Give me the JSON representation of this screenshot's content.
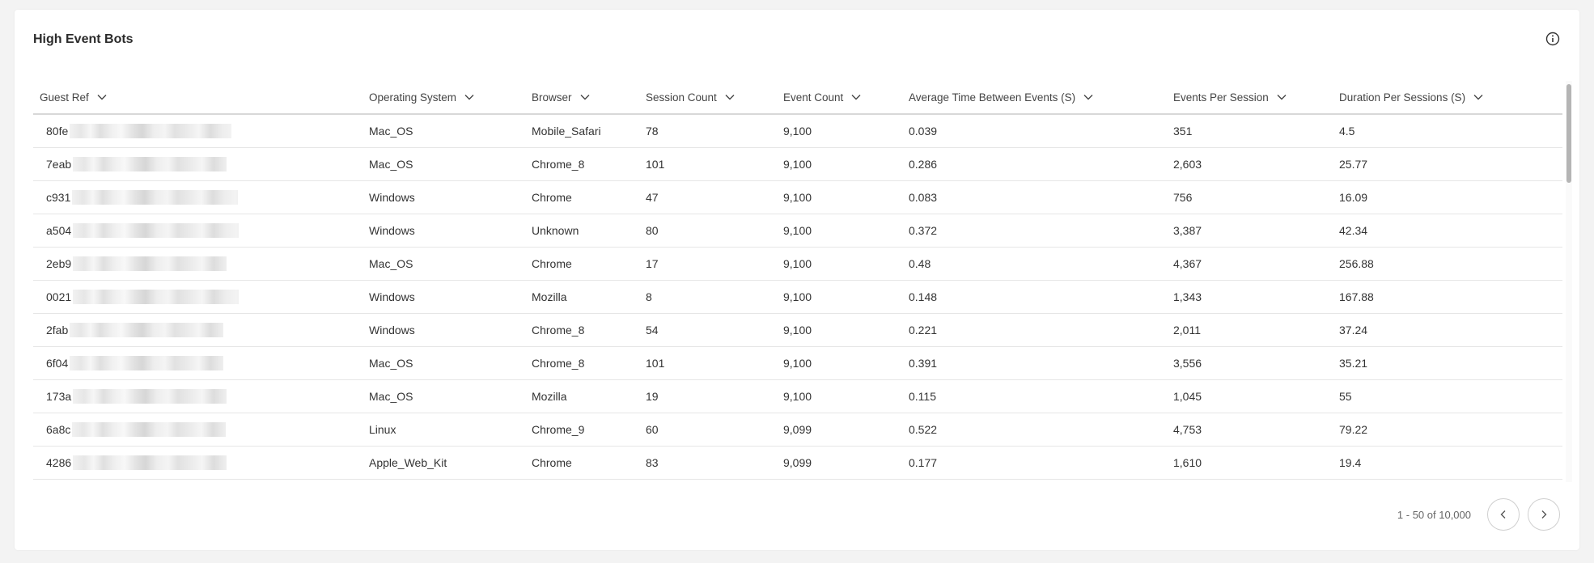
{
  "card": {
    "title": "High Event Bots"
  },
  "icons": {
    "info": "info-icon",
    "sort": "chevron-down-icon",
    "prev": "chevron-left-icon",
    "next": "chevron-right-icon"
  },
  "table": {
    "columns": [
      {
        "label": "Guest Ref"
      },
      {
        "label": "Operating System"
      },
      {
        "label": "Browser"
      },
      {
        "label": "Session Count"
      },
      {
        "label": "Event Count"
      },
      {
        "label": "Average Time Between Events (S)"
      },
      {
        "label": "Events Per Session"
      },
      {
        "label": "Duration Per Sessions (S)"
      }
    ],
    "rows": [
      {
        "guest_ref": "80fe",
        "os": "Mac_OS",
        "browser": "Mobile_Safari",
        "sessions": "78",
        "events": "9,100",
        "avg_time": "0.039",
        "events_per_session": "351",
        "duration": "4.5"
      },
      {
        "guest_ref": "7eab",
        "os": "Mac_OS",
        "browser": "Chrome_8",
        "sessions": "101",
        "events": "9,100",
        "avg_time": "0.286",
        "events_per_session": "2,603",
        "duration": "25.77"
      },
      {
        "guest_ref": "c931",
        "os": "Windows",
        "browser": "Chrome",
        "sessions": "47",
        "events": "9,100",
        "avg_time": "0.083",
        "events_per_session": "756",
        "duration": "16.09"
      },
      {
        "guest_ref": "a504",
        "os": "Windows",
        "browser": "Unknown",
        "sessions": "80",
        "events": "9,100",
        "avg_time": "0.372",
        "events_per_session": "3,387",
        "duration": "42.34"
      },
      {
        "guest_ref": "2eb9",
        "os": "Mac_OS",
        "browser": "Chrome",
        "sessions": "17",
        "events": "9,100",
        "avg_time": "0.48",
        "events_per_session": "4,367",
        "duration": "256.88"
      },
      {
        "guest_ref": "0021",
        "os": "Windows",
        "browser": "Mozilla",
        "sessions": "8",
        "events": "9,100",
        "avg_time": "0.148",
        "events_per_session": "1,343",
        "duration": "167.88"
      },
      {
        "guest_ref": "2fab",
        "os": "Windows",
        "browser": "Chrome_8",
        "sessions": "54",
        "events": "9,100",
        "avg_time": "0.221",
        "events_per_session": "2,011",
        "duration": "37.24"
      },
      {
        "guest_ref": "6f04",
        "os": "Mac_OS",
        "browser": "Chrome_8",
        "sessions": "101",
        "events": "9,100",
        "avg_time": "0.391",
        "events_per_session": "3,556",
        "duration": "35.21"
      },
      {
        "guest_ref": "173a",
        "os": "Mac_OS",
        "browser": "Mozilla",
        "sessions": "19",
        "events": "9,100",
        "avg_time": "0.115",
        "events_per_session": "1,045",
        "duration": "55"
      },
      {
        "guest_ref": "6a8c",
        "os": "Linux",
        "browser": "Chrome_9",
        "sessions": "60",
        "events": "9,099",
        "avg_time": "0.522",
        "events_per_session": "4,753",
        "duration": "79.22"
      },
      {
        "guest_ref": "4286",
        "os": "Apple_Web_Kit",
        "browser": "Chrome",
        "sessions": "83",
        "events": "9,099",
        "avg_time": "0.177",
        "events_per_session": "1,610",
        "duration": "19.4"
      }
    ]
  },
  "pagination": {
    "range_text": "1 - 50 of 10,000"
  }
}
